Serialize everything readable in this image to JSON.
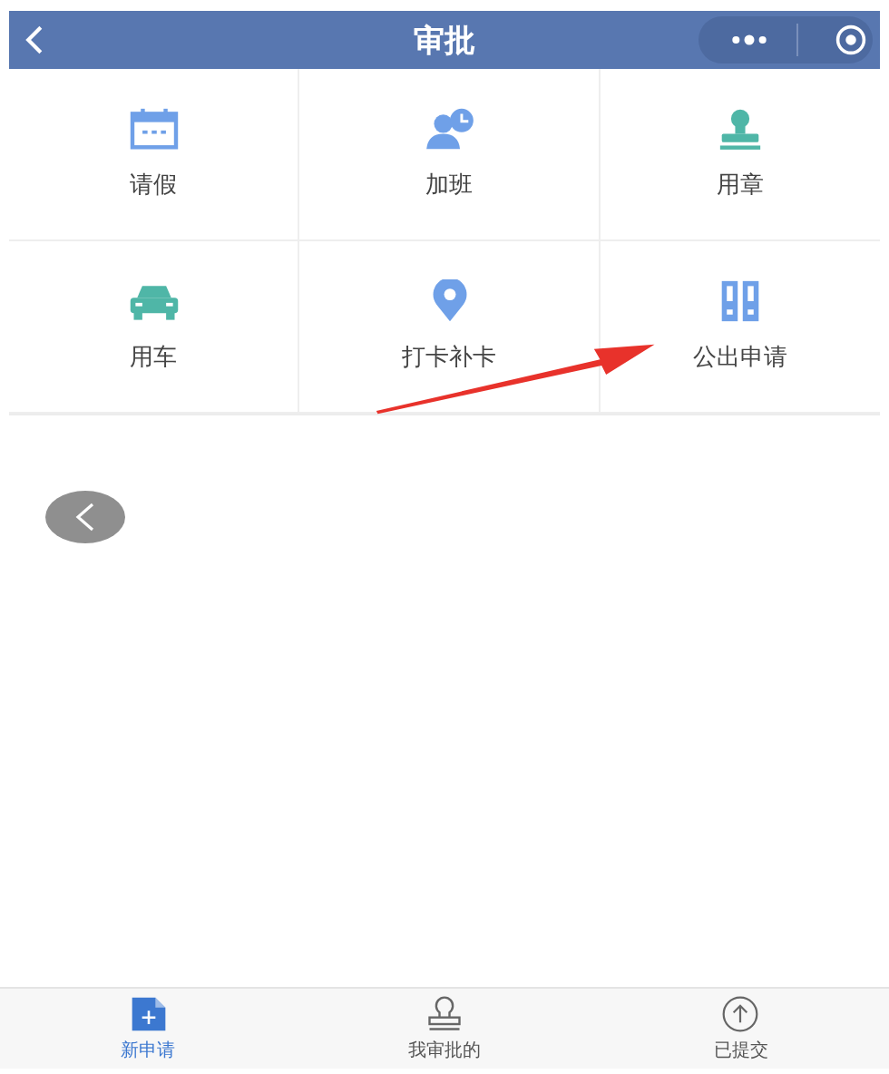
{
  "header": {
    "title": "审批"
  },
  "grid": [
    {
      "kind": "calendar",
      "label": "请假"
    },
    {
      "kind": "overtime",
      "label": "加班"
    },
    {
      "kind": "stamp",
      "label": "用章"
    },
    {
      "kind": "car",
      "label": "用车"
    },
    {
      "kind": "pin",
      "label": "打卡补卡"
    },
    {
      "kind": "columns",
      "label": "公出申请"
    }
  ],
  "tabs": [
    {
      "kind": "new",
      "label": "新申请",
      "selected": true
    },
    {
      "kind": "approve",
      "label": "我审批的",
      "selected": false
    },
    {
      "kind": "submitted",
      "label": "已提交",
      "selected": false
    }
  ]
}
